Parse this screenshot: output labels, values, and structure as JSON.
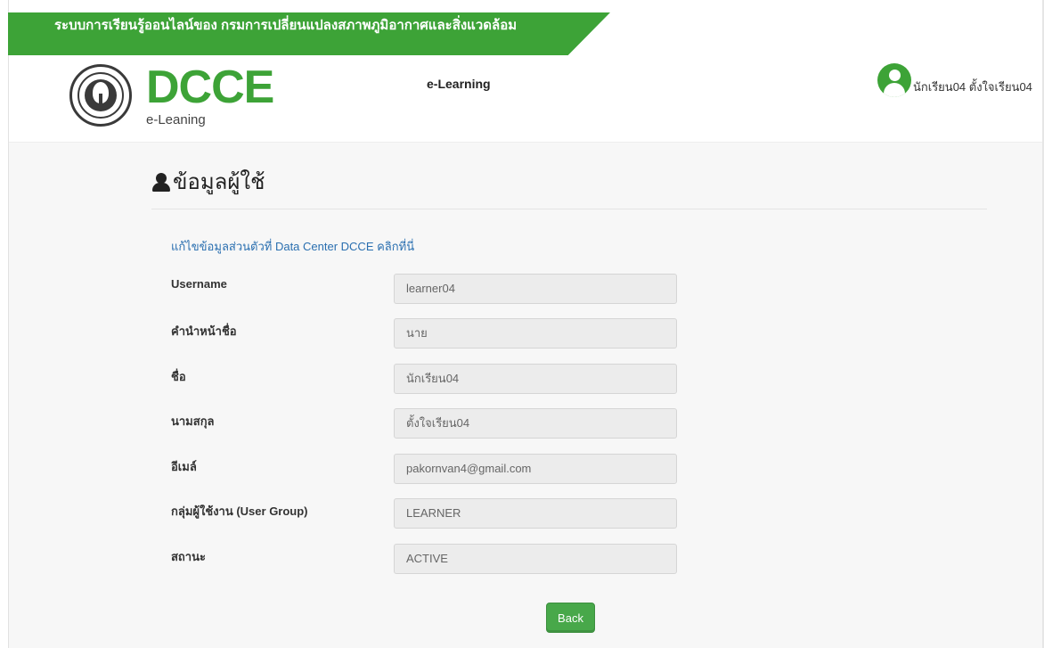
{
  "banner": {
    "text": "ระบบการเรียนรู้ออนไลน์ของ กรมการเปลี่ยนแปลงสภาพภูมิอากาศและสิ่งแวดล้อม"
  },
  "brand": {
    "name": "DCCE",
    "subtitle": "e-Leaning"
  },
  "header": {
    "center_title": "e-Learning"
  },
  "user": {
    "display_name": "นักเรียน04 ตั้งใจเรียน04"
  },
  "page": {
    "title": "ข้อมูลผู้ใช้",
    "edit_link": "แก้ไขข้อมูลส่วนตัวที่ Data Center DCCE คลิกที่นี่"
  },
  "fields": [
    {
      "label": "Username",
      "value": "learner04"
    },
    {
      "label": "คำนำหน้าชื่อ",
      "value": "นาย"
    },
    {
      "label": "ชื่อ",
      "value": "นักเรียน04"
    },
    {
      "label": "นามสกุล",
      "value": "ตั้งใจเรียน04"
    },
    {
      "label": "อีเมล์",
      "value": "pakornvan4@gmail.com"
    },
    {
      "label": "กลุ่มผู้ใช้งาน (User Group)",
      "value": "LEARNER"
    },
    {
      "label": "สถานะ",
      "value": "ACTIVE"
    }
  ],
  "actions": {
    "back_label": "Back"
  },
  "colors": {
    "brand_green": "#3da337",
    "link_blue": "#2a6fb0",
    "button_green": "#48a84a"
  }
}
